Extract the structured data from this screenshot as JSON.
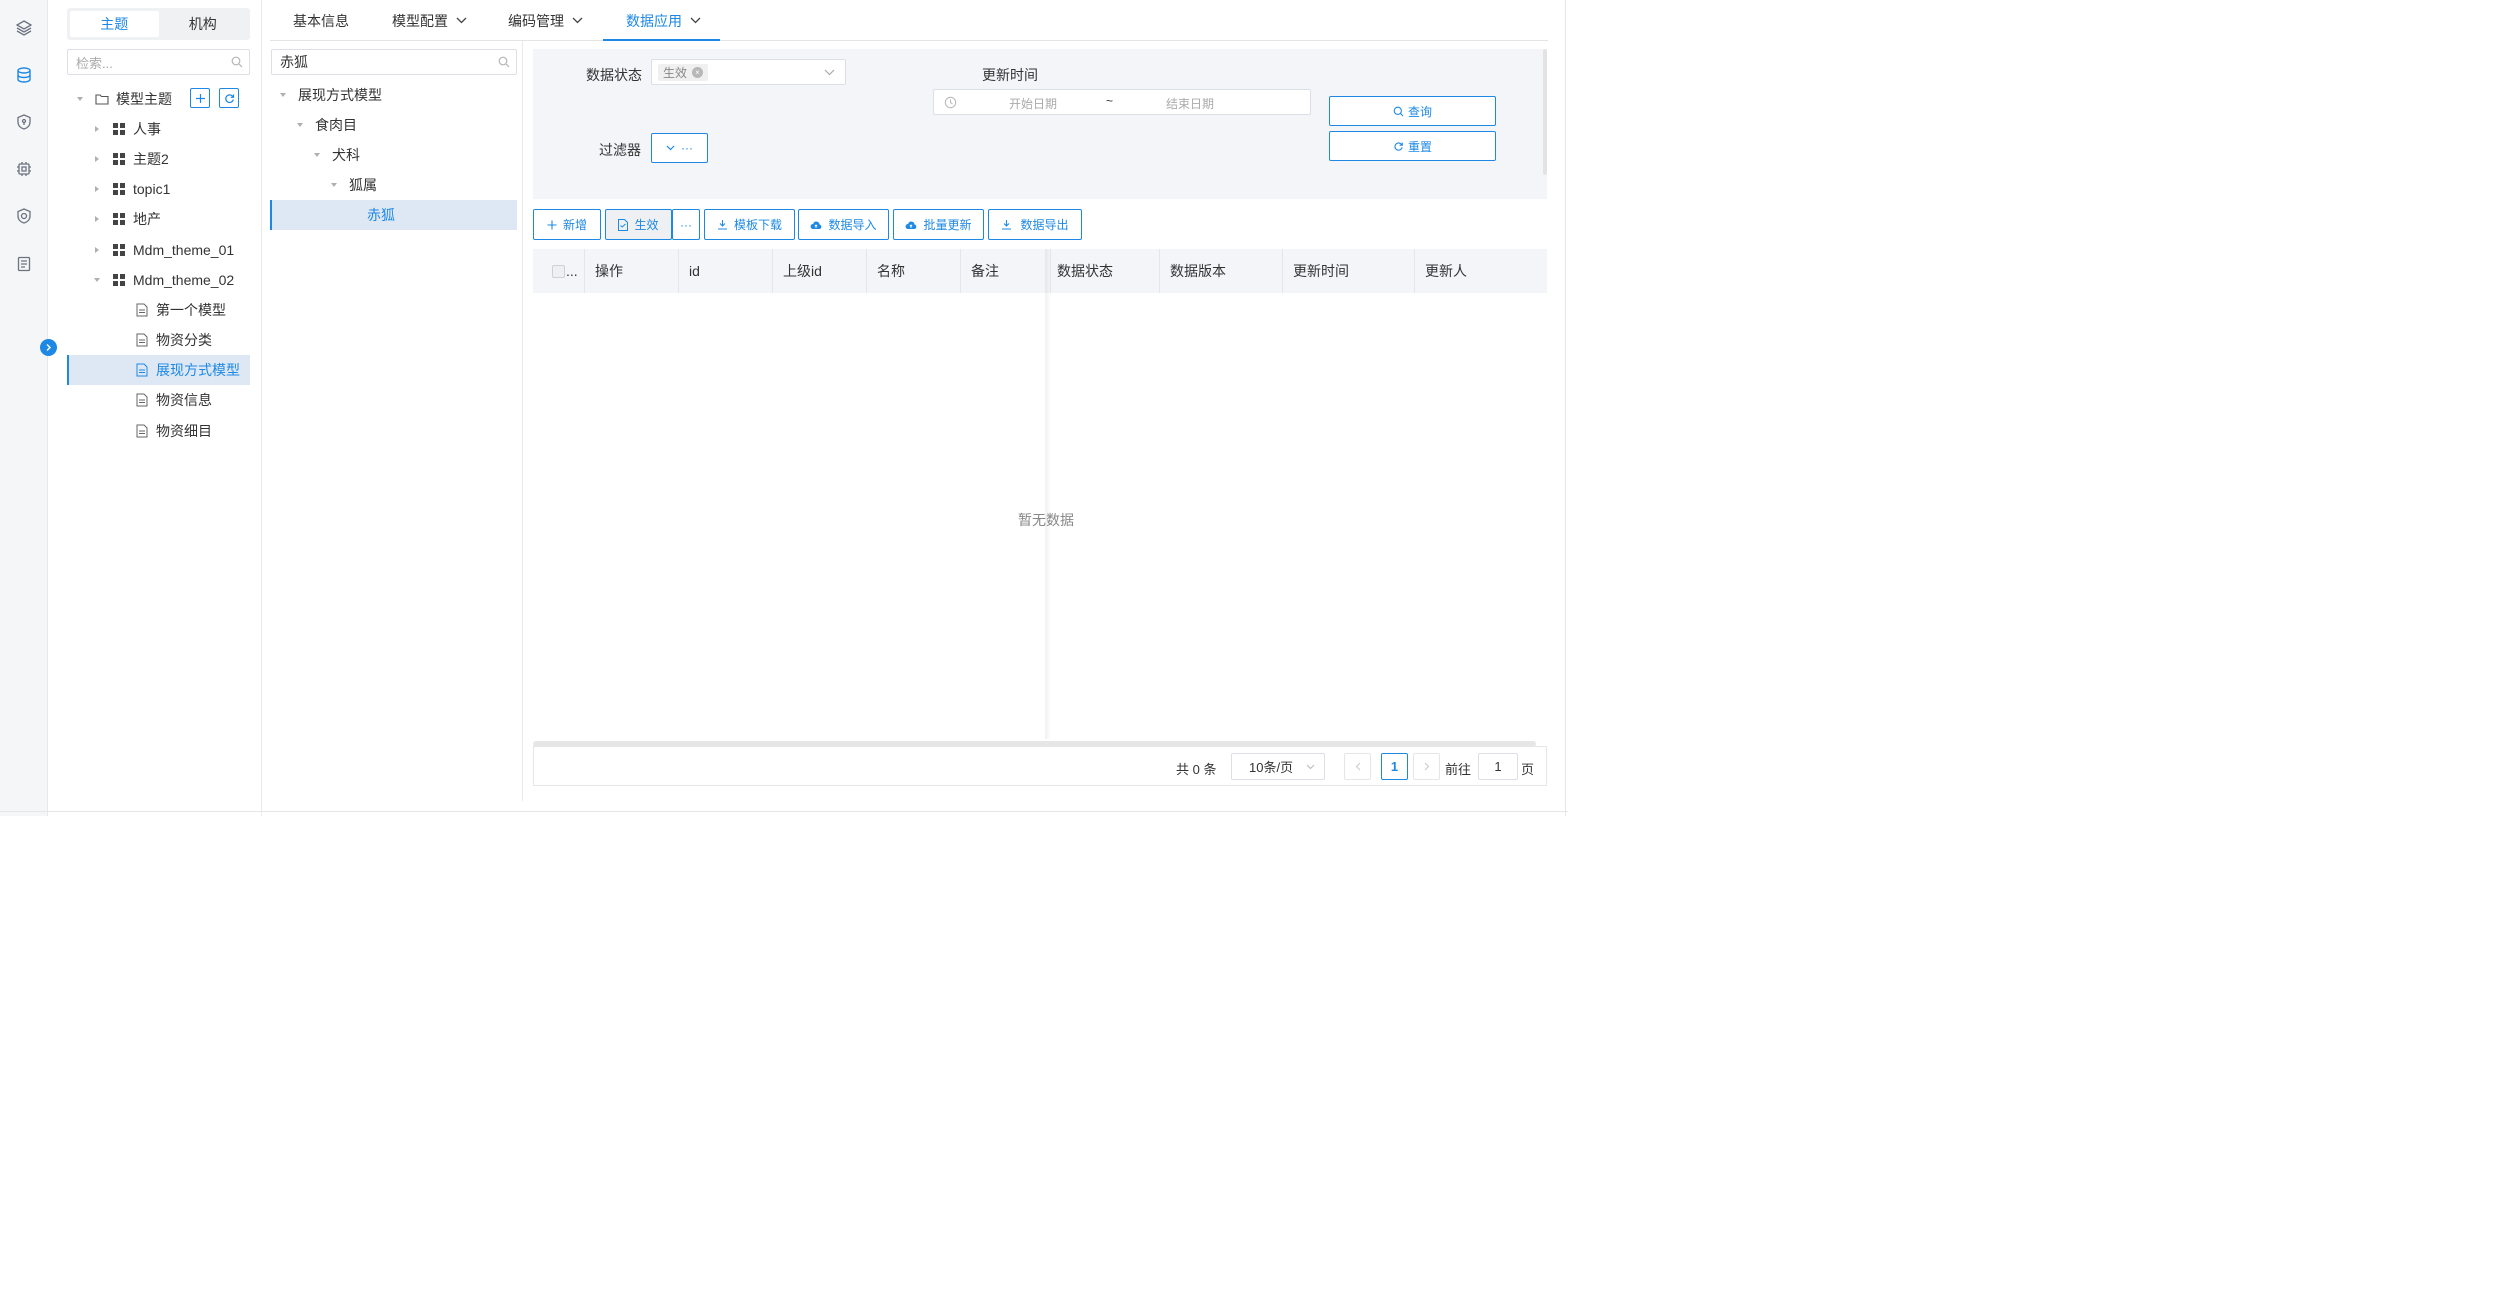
{
  "colors": {
    "accent": "#1e88e5",
    "selected_bg": "#dde8f4",
    "filter_bg": "#f3f5f9"
  },
  "rail": {
    "icons": [
      "layers-icon",
      "database-icon",
      "shield-icon",
      "chip-icon",
      "security-icon",
      "report-icon"
    ]
  },
  "theme_panel": {
    "segments": [
      "主题",
      "机构"
    ],
    "search_placeholder": "检索...",
    "root_label": "模型主题",
    "items": [
      "人事",
      "主题2",
      "topic1",
      "地产",
      "Mdm_theme_01",
      "Mdm_theme_02"
    ],
    "children": [
      "第一个模型",
      "物资分类",
      "展现方式模型",
      "物资信息",
      "物资细目"
    ]
  },
  "tabs": [
    "基本信息",
    "模型配置",
    "编码管理",
    "数据应用"
  ],
  "mid_panel": {
    "search_value": "赤狐",
    "nodes": [
      "展现方式模型",
      "食肉目",
      "犬科",
      "狐属",
      "赤狐"
    ]
  },
  "filter": {
    "status_label": "数据状态",
    "status_tag": "生效",
    "update_time_label": "更新时间",
    "start_placeholder": "开始日期",
    "end_placeholder": "结束日期",
    "range_sep": "~",
    "filter_label": "过滤器",
    "filter_button": "···",
    "query_label": "查询",
    "reset_label": "重置"
  },
  "toolbar": {
    "add": "新增",
    "activate": "生效",
    "more": "···",
    "template_download": "模板下载",
    "data_import": "数据导入",
    "batch_update": "批量更新",
    "data_export": "数据导出"
  },
  "table": {
    "select_label": "...",
    "columns": [
      "操作",
      "id",
      "上级id",
      "名称",
      "备注",
      "数据状态",
      "数据版本",
      "更新时间",
      "更新人"
    ],
    "empty_text": "暂无数据"
  },
  "pagination": {
    "total": "共 0 条",
    "page_size": "10条/页",
    "current_page": "1",
    "goto_label": "前往",
    "goto_value": "1",
    "page_suffix": "页"
  }
}
